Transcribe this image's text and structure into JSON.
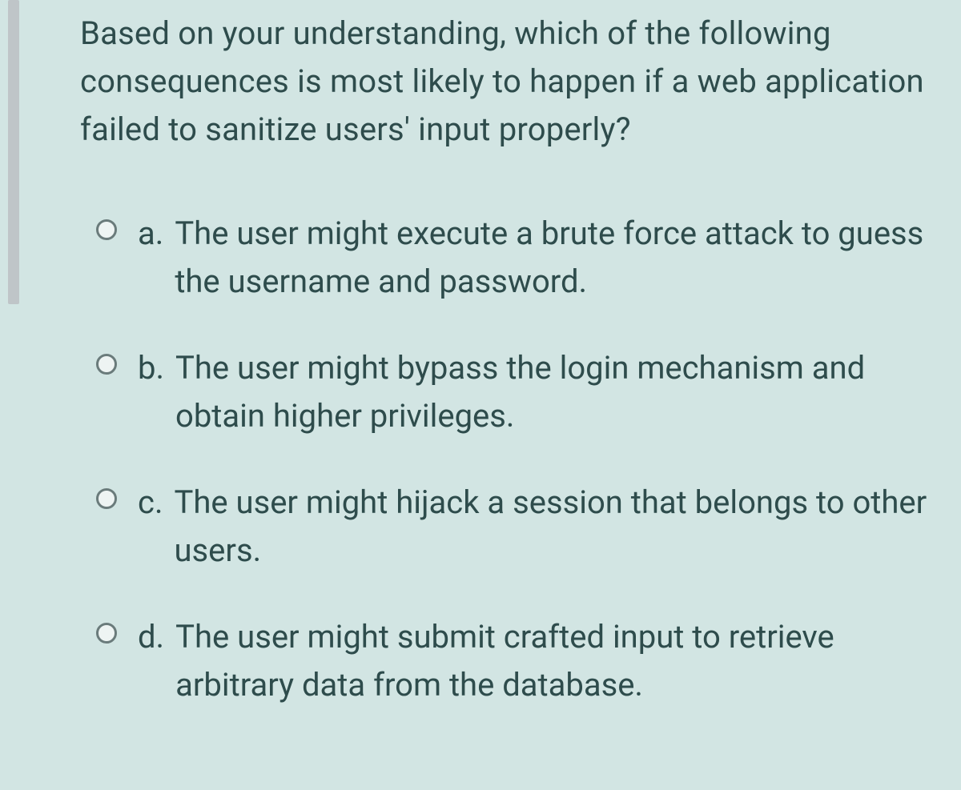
{
  "question": "Based on your understanding, which of the following consequences is most likely to happen if a web application failed to sanitize users' input properly?",
  "options": [
    {
      "letter": "a.",
      "text": "The user might execute a brute force attack to guess the username and password."
    },
    {
      "letter": "b.",
      "text": "The user might bypass the login mechanism and obtain higher privileges."
    },
    {
      "letter": "c.",
      "text": "The user might hijack a session that belongs to other users."
    },
    {
      "letter": "d.",
      "text": "The user might submit crafted input to retrieve arbitrary data from the database."
    }
  ]
}
